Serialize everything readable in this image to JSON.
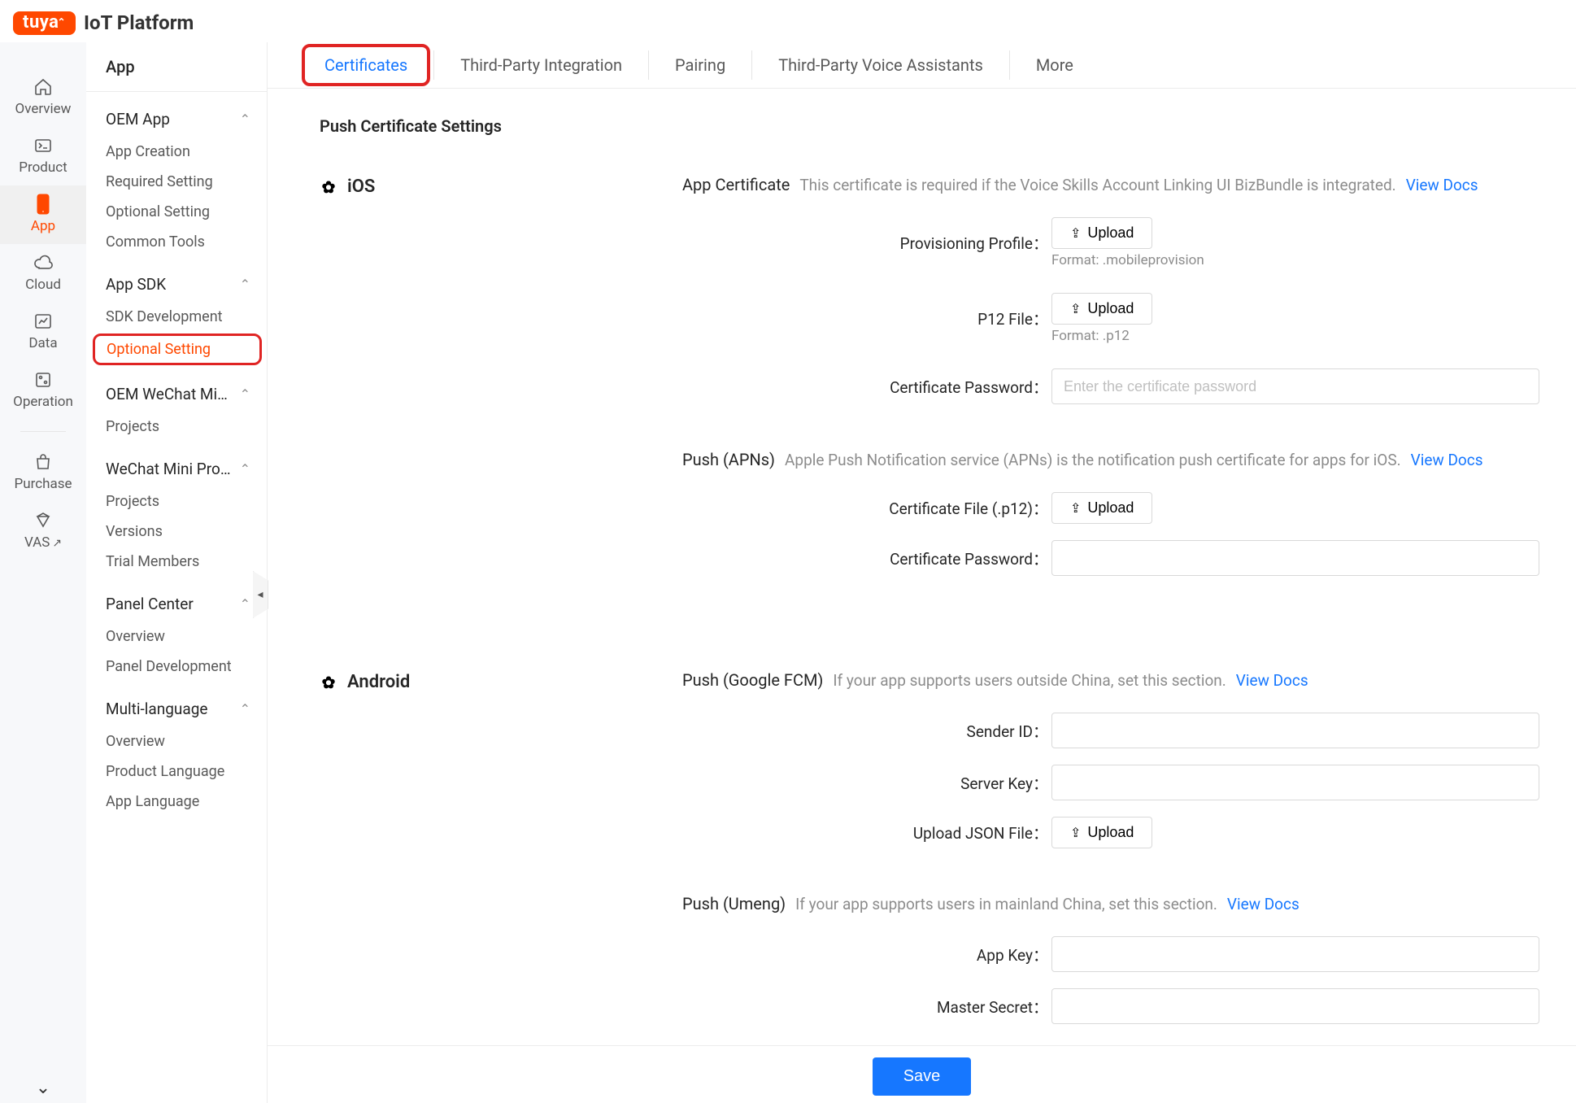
{
  "brand": {
    "logo": "tuya",
    "title": "IoT Platform"
  },
  "rail": {
    "items": [
      {
        "label": "Overview"
      },
      {
        "label": "Product"
      },
      {
        "label": "App",
        "active": true
      },
      {
        "label": "Cloud"
      },
      {
        "label": "Data"
      },
      {
        "label": "Operation"
      }
    ],
    "after_sep": [
      {
        "label": "Purchase"
      },
      {
        "label": "VAS",
        "external": true
      }
    ]
  },
  "sidebar": {
    "title": "App",
    "groups": [
      {
        "header": "OEM App",
        "items": [
          "App Creation",
          "Required Setting",
          "Optional Setting",
          "Common Tools"
        ]
      },
      {
        "header": "App SDK",
        "items": [
          "SDK Development",
          "Optional Setting"
        ],
        "active_item_index": 1,
        "active_highlight": true
      },
      {
        "header": "OEM WeChat Min…",
        "items": [
          "Projects"
        ]
      },
      {
        "header": "WeChat Mini Pro…",
        "items": [
          "Projects",
          "Versions",
          "Trial Members"
        ]
      },
      {
        "header": "Panel Center",
        "items": [
          "Overview",
          "Panel Development"
        ]
      },
      {
        "header": "Multi-language",
        "items": [
          "Overview",
          "Product Language",
          "App Language"
        ]
      }
    ]
  },
  "tabs": [
    "Certificates",
    "Third-Party Integration",
    "Pairing",
    "Third-Party Voice Assistants",
    "More"
  ],
  "active_tab_index": 0,
  "content": {
    "section_title": "Push Certificate Settings",
    "ios": {
      "label": "iOS",
      "app_cert": {
        "title": "App Certificate",
        "desc": "This certificate is required if the Voice Skills Account Linking UI BizBundle is integrated.",
        "link": "View Docs",
        "fields": {
          "provisioning_profile": {
            "label": "Provisioning Profile",
            "upload": "Upload",
            "hint": "Format: .mobileprovision"
          },
          "p12_file": {
            "label": "P12 File",
            "upload": "Upload",
            "hint": "Format: .p12"
          },
          "cert_password": {
            "label": "Certificate Password",
            "placeholder": "Enter the certificate password"
          }
        }
      },
      "apns": {
        "title": "Push (APNs)",
        "desc": "Apple Push Notification service (APNs) is the notification push certificate for apps for iOS.",
        "link": "View Docs",
        "fields": {
          "cert_file": {
            "label": "Certificate File (.p12)",
            "upload": "Upload"
          },
          "cert_password": {
            "label": "Certificate Password"
          }
        }
      }
    },
    "android": {
      "label": "Android",
      "fcm": {
        "title": "Push (Google FCM)",
        "desc": "If your app supports users outside China, set this section.",
        "link": "View Docs",
        "fields": {
          "sender_id": {
            "label": "Sender ID"
          },
          "server_key": {
            "label": "Server Key"
          },
          "json_file": {
            "label": "Upload JSON File",
            "upload": "Upload"
          }
        }
      },
      "umeng": {
        "title": "Push (Umeng)",
        "desc": "If your app supports users in mainland China, set this section.",
        "link": "View Docs",
        "fields": {
          "app_key": {
            "label": "App Key"
          },
          "master_secret": {
            "label": "Master Secret"
          }
        }
      }
    }
  },
  "footer": {
    "save": "Save"
  }
}
